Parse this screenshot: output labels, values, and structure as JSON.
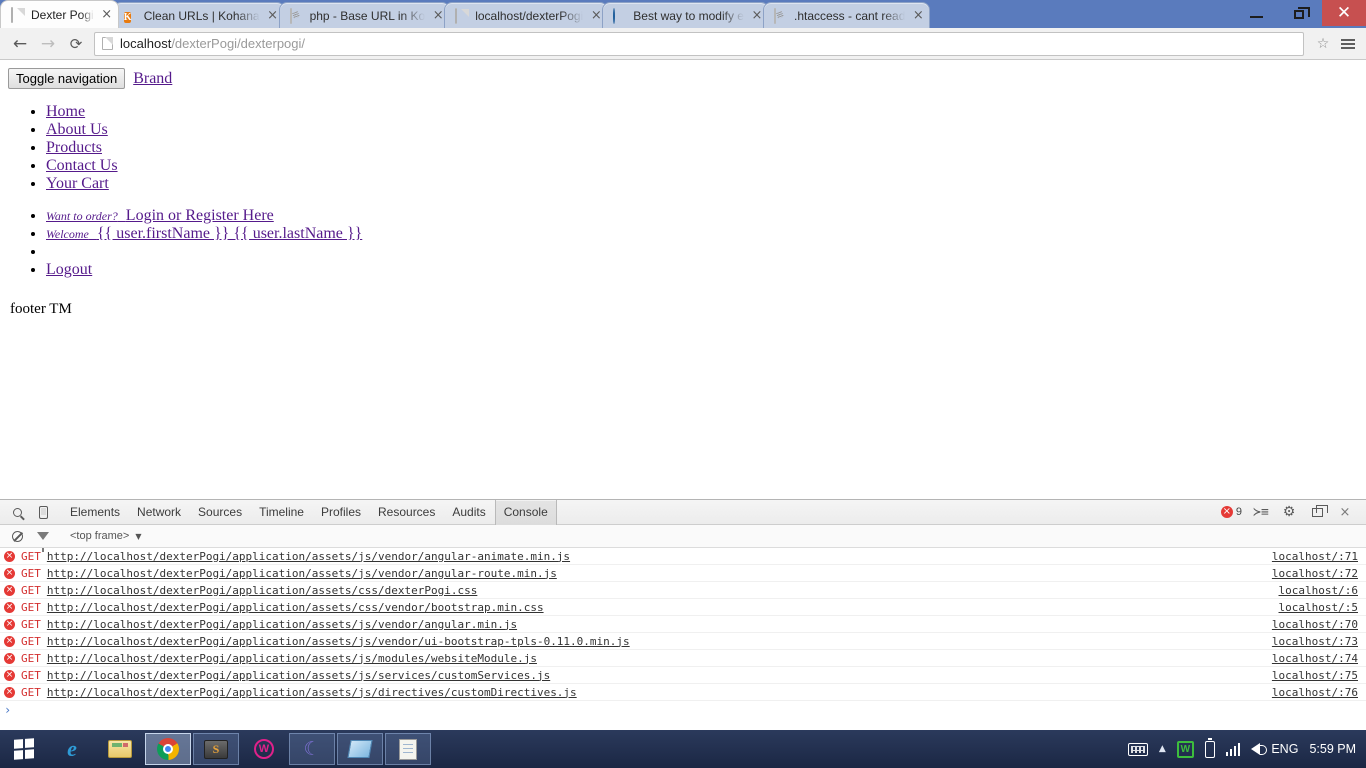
{
  "window": {
    "controls": {
      "minimize": "minimize-button",
      "restore": "restore-button",
      "close_label": "✕"
    }
  },
  "browser": {
    "tabs": [
      {
        "title": "Dexter Pogi",
        "favicon": "document-icon",
        "active": true,
        "close_label": "×"
      },
      {
        "title": "Clean URLs | Kohana",
        "favicon": "kohana-icon",
        "active": false,
        "close_label": "×"
      },
      {
        "title": "php - Base URL in Ko",
        "favicon": "stackoverflow-icon",
        "active": false,
        "close_label": "×"
      },
      {
        "title": "localhost/dexterPogi",
        "favicon": "document-icon",
        "active": false,
        "close_label": "×"
      },
      {
        "title": "Best way to modify e",
        "favicon": "globe-icon",
        "active": false,
        "close_label": "×"
      },
      {
        "title": ".htaccess - cant read",
        "favicon": "stackoverflow-icon",
        "active": false,
        "close_label": "×"
      }
    ],
    "toolbar": {
      "back_label": "←",
      "forward_label": "→",
      "reload_label": "⟳",
      "url_host": "localhost",
      "url_path": "/dexterPogi/dexterpogi/",
      "star_label": "☆"
    }
  },
  "page": {
    "toggle_nav_label": "Toggle navigation",
    "brand_label": "Brand",
    "nav_items": [
      {
        "label": "Home"
      },
      {
        "label": "About Us"
      },
      {
        "label": "Products"
      },
      {
        "label": "Contact Us"
      },
      {
        "label": "Your Cart"
      }
    ],
    "auth_items": [
      {
        "small": "Want to order?",
        "link": "Login or Register Here"
      },
      {
        "small": "Welcome",
        "link": "{{ user.firstName }} {{ user.lastName }}"
      }
    ],
    "logout_label": "Logout",
    "footer_text": "footer TM"
  },
  "devtools": {
    "tabs": [
      {
        "label": "Elements",
        "active": false
      },
      {
        "label": "Network",
        "active": false
      },
      {
        "label": "Sources",
        "active": false
      },
      {
        "label": "Timeline",
        "active": false
      },
      {
        "label": "Profiles",
        "active": false
      },
      {
        "label": "Resources",
        "active": false
      },
      {
        "label": "Audits",
        "active": false
      },
      {
        "label": "Console",
        "active": true
      }
    ],
    "error_count": "9",
    "right_icons": [
      "console-drawer-icon",
      "settings-gear-icon",
      "dock-position-icon",
      "close-devtools-icon"
    ],
    "filterbar": {
      "clear_icon": "clear-console-icon",
      "filter_icon": "filter-icon",
      "frame_label": "<top frame>",
      "caret": "▼"
    },
    "console_logs": [
      {
        "icon": "×",
        "method": "GET",
        "url": "http://localhost/dexterPogi/application/assets/js/vendor/angular-animate.min.js",
        "source": "localhost/:71"
      },
      {
        "icon": "×",
        "method": "GET",
        "url": "http://localhost/dexterPogi/application/assets/js/vendor/angular-route.min.js",
        "source": "localhost/:72"
      },
      {
        "icon": "×",
        "method": "GET",
        "url": "http://localhost/dexterPogi/application/assets/css/dexterPogi.css",
        "source": "localhost/:6"
      },
      {
        "icon": "×",
        "method": "GET",
        "url": "http://localhost/dexterPogi/application/assets/css/vendor/bootstrap.min.css",
        "source": "localhost/:5"
      },
      {
        "icon": "×",
        "method": "GET",
        "url": "http://localhost/dexterPogi/application/assets/js/vendor/angular.min.js",
        "source": "localhost/:70"
      },
      {
        "icon": "×",
        "method": "GET",
        "url": "http://localhost/dexterPogi/application/assets/js/vendor/ui-bootstrap-tpls-0.11.0.min.js",
        "source": "localhost/:73"
      },
      {
        "icon": "×",
        "method": "GET",
        "url": "http://localhost/dexterPogi/application/assets/js/modules/websiteModule.js",
        "source": "localhost/:74"
      },
      {
        "icon": "×",
        "method": "GET",
        "url": "http://localhost/dexterPogi/application/assets/js/services/customServices.js",
        "source": "localhost/:75"
      },
      {
        "icon": "×",
        "method": "GET",
        "url": "http://localhost/dexterPogi/application/assets/js/directives/customDirectives.js",
        "source": "localhost/:76"
      }
    ],
    "prompt_caret": "›"
  },
  "taskbar": {
    "start_name": "start-button",
    "items": [
      {
        "name": "taskbar-internet-explorer",
        "kind": "ie",
        "state": "pinned"
      },
      {
        "name": "taskbar-file-explorer",
        "kind": "folder",
        "state": "pinned"
      },
      {
        "name": "taskbar-chrome",
        "kind": "chrome",
        "state": "active"
      },
      {
        "name": "taskbar-sublime-text",
        "kind": "sublime",
        "state": "framed",
        "glyph": "S"
      },
      {
        "name": "taskbar-wamp",
        "kind": "wamp",
        "state": "pinned",
        "glyph": "W"
      },
      {
        "name": "taskbar-navicat",
        "kind": "navicat",
        "state": "framed",
        "glyph": "☾"
      },
      {
        "name": "taskbar-paint",
        "kind": "paint",
        "state": "framed"
      },
      {
        "name": "taskbar-notepad",
        "kind": "notepad",
        "state": "framed"
      }
    ],
    "tray": {
      "keyboard_icon": "keyboard-icon",
      "overflow_label": "▲",
      "xampp_glyph": "W",
      "battery_icon": "battery-icon",
      "signal_icon": "signal-icon",
      "volume_icon": "volume-icon",
      "language": "ENG",
      "clock": "5:59 PM"
    }
  },
  "colors": {
    "tabstrip_blue": "#5a7bbd",
    "close_red": "#c75050",
    "link_purple": "#551a8b",
    "error_red": "#e53935",
    "taskbar_navy": "#1b2744"
  }
}
